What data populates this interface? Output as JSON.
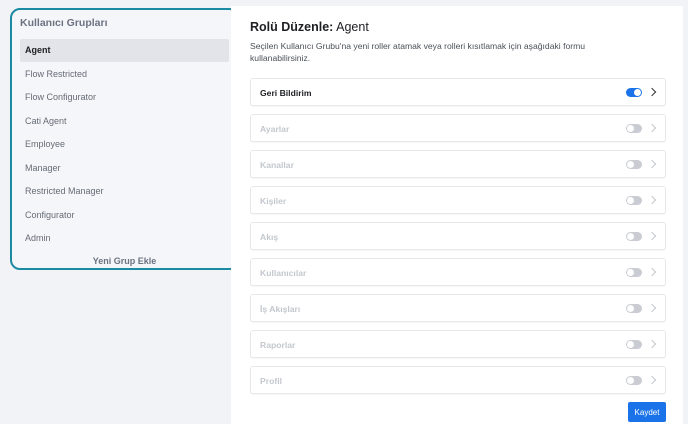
{
  "groups_panel": {
    "title": "Kullanıcı Grupları",
    "items": [
      {
        "label": "Agent",
        "active": true
      },
      {
        "label": "Flow Restricted",
        "active": false
      },
      {
        "label": "Flow Configurator",
        "active": false
      },
      {
        "label": "Cati Agent",
        "active": false
      },
      {
        "label": "Employee",
        "active": false
      },
      {
        "label": "Manager",
        "active": false
      },
      {
        "label": "Restricted Manager",
        "active": false
      },
      {
        "label": "Configurator",
        "active": false
      },
      {
        "label": "Admin",
        "active": false
      }
    ],
    "add_label": "Yeni Grup Ekle"
  },
  "role_editor": {
    "title_prefix": "Rolü Düzenle:",
    "title_role": "Agent",
    "description": "Seçilen Kullanıcı Grubu'na yeni roller atamak veya rolleri kısıtlamak için aşağıdaki formu kullanabilirsiniz.",
    "roles": [
      {
        "label": "Geri Bildirim",
        "enabled": true
      },
      {
        "label": "Ayarlar",
        "enabled": false
      },
      {
        "label": "Kanallar",
        "enabled": false
      },
      {
        "label": "Kişiler",
        "enabled": false
      },
      {
        "label": "Akış",
        "enabled": false
      },
      {
        "label": "Kullanıcılar",
        "enabled": false
      },
      {
        "label": "İş Akışları",
        "enabled": false
      },
      {
        "label": "Raporlar",
        "enabled": false
      },
      {
        "label": "Profil",
        "enabled": false
      }
    ],
    "save_label": "Kaydet"
  },
  "colors": {
    "accent": "#1a73e8",
    "panel_border": "#1c8aa3"
  }
}
